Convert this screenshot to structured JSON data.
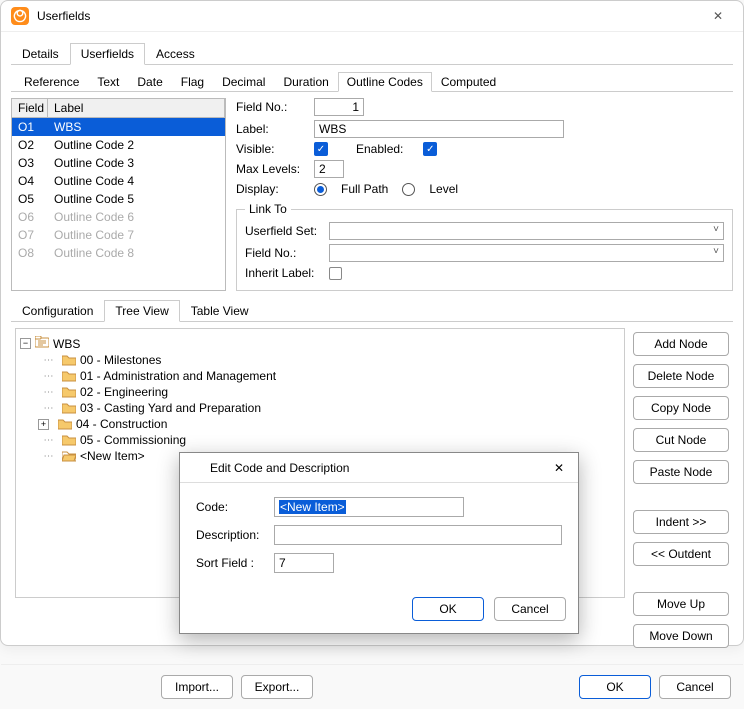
{
  "window": {
    "title": "Userfields"
  },
  "mainTabs": [
    "Details",
    "Userfields",
    "Access"
  ],
  "mainTabsActive": 1,
  "subTabs": [
    "Reference",
    "Text",
    "Date",
    "Flag",
    "Decimal",
    "Duration",
    "Outline Codes",
    "Computed"
  ],
  "subTabsActive": 6,
  "grid": {
    "headers": {
      "field": "Field",
      "label": "Label"
    },
    "rows": [
      {
        "field": "O1",
        "label": "WBS",
        "selected": true
      },
      {
        "field": "O2",
        "label": "Outline Code 2"
      },
      {
        "field": "O3",
        "label": "Outline Code 3"
      },
      {
        "field": "O4",
        "label": "Outline Code 4"
      },
      {
        "field": "O5",
        "label": "Outline Code 5"
      },
      {
        "field": "O6",
        "label": "Outline Code 6",
        "disabled": true
      },
      {
        "field": "O7",
        "label": "Outline Code 7",
        "disabled": true
      },
      {
        "field": "O8",
        "label": "Outline Code 8",
        "disabled": true
      }
    ]
  },
  "form": {
    "fieldNoLabel": "Field No.:",
    "fieldNo": "1",
    "labelLabel": "Label:",
    "labelValue": "WBS",
    "visibleLabel": "Visible:",
    "enabledLabel": "Enabled:",
    "maxLevelsLabel": "Max Levels:",
    "maxLevels": "2",
    "displayLabel": "Display:",
    "displayFullPath": "Full Path",
    "displayLevel": "Level",
    "linkToLegend": "Link To",
    "userfieldSetLabel": "Userfield Set:",
    "linkFieldNoLabel": "Field No.:",
    "inheritLabelLabel": "Inherit Label:"
  },
  "viewTabs": [
    "Configuration",
    "Tree View",
    "Table View"
  ],
  "viewTabsActive": 1,
  "tree": {
    "root": "WBS",
    "items": [
      "00 - Milestones",
      "01 - Administration and Management",
      "02 - Engineering",
      "03 - Casting Yard and Preparation",
      "04 - Construction",
      "05 - Commissioning",
      "<New Item>"
    ],
    "expandableIndex": 4
  },
  "treeButtons": {
    "addNode": "Add Node",
    "deleteNode": "Delete Node",
    "copyNode": "Copy Node",
    "cutNode": "Cut Node",
    "pasteNode": "Paste Node",
    "indent": "Indent >>",
    "outdent": "<< Outdent",
    "moveUp": "Move Up",
    "moveDown": "Move Down"
  },
  "modal": {
    "title": "Edit Code and Description",
    "codeLabel": "Code:",
    "codeValue": "<New Item>",
    "descLabel": "Description:",
    "descValue": "",
    "sortLabel": "Sort Field :",
    "sortValue": "7",
    "ok": "OK",
    "cancel": "Cancel"
  },
  "footer": {
    "import": "Import...",
    "export": "Export...",
    "ok": "OK",
    "cancel": "Cancel"
  }
}
